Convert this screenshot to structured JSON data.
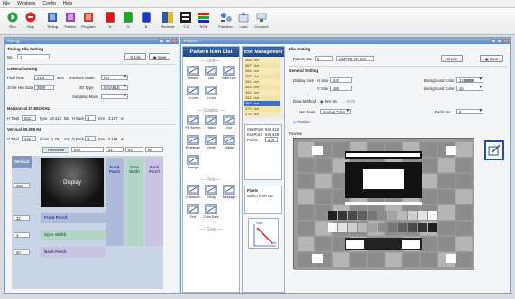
{
  "menu": [
    "File",
    "Windows",
    "Config",
    "Help"
  ],
  "toolbar": [
    {
      "label": "Run",
      "icon": "run-icon",
      "color": "#2e9a3c"
    },
    {
      "label": "Stop",
      "icon": "stop-icon",
      "color": "#d42a2a"
    },
    {
      "label": "Timing",
      "icon": "timing-icon",
      "color": "#3060c0"
    },
    {
      "label": "Pattern",
      "icon": "pattern-icon",
      "color": "#9a40c0"
    },
    {
      "label": "Program",
      "icon": "program-icon",
      "color": "#d63a2a"
    },
    {
      "label": "R",
      "icon": "red-icon",
      "color": "#e01818"
    },
    {
      "label": "G",
      "icon": "green-icon",
      "color": "#18b018"
    },
    {
      "label": "B",
      "icon": "blue-icon",
      "color": "#1838d8"
    },
    {
      "label": "Reverse",
      "icon": "reverse-icon",
      "color": "#2a5aa8"
    },
    {
      "label": "Y-Z",
      "icon": "yz-icon",
      "color": "#1a1a1a"
    },
    {
      "label": "RGB",
      "icon": "rgb-icon",
      "color": "#c02020"
    },
    {
      "label": "Function",
      "icon": "function-icon",
      "color": "#4a7ac8"
    },
    {
      "label": "Load",
      "icon": "load-icon",
      "color": "#4a7ac8"
    },
    {
      "label": "Connect",
      "icon": "connect-icon",
      "color": "#3a8a3a"
    }
  ],
  "timing": {
    "title": "Timing",
    "file_section": "Timing File Setting",
    "no_label": "No.",
    "no_value": "1",
    "list_btn": "List",
    "save_btn": "Save",
    "general_section": "General Setting",
    "pixel_rate_label": "Pixel Rate",
    "pixel_rate_value": "31.5",
    "pixel_rate_unit": "Mhz",
    "interlace_label": "Interlace Mode",
    "interlace_value": "NO",
    "bitdata_label": "10-bit Hex Data",
    "bitdata_value": "3900",
    "threed_label": "3D Type",
    "threed_value": "DISABLE",
    "sampling_label": "Sampling Mode",
    "horizontal_section": "Horizontal 37.861 KHz",
    "h_total_label": "H Total",
    "h_total_value": "832",
    "h_fporch_label": "Fpor",
    "h_fporch_value": "26.413",
    "h_fporch_unit": "kB",
    "h_back_label": "H Back",
    "h_back_value": "4",
    "h_back_unit": "mm",
    "h_last_value": "3.167",
    "h_last_unit": "m",
    "vertical_section": "Vertical 85.008 Hz",
    "v_total_label": "V Total",
    "v_total_value": "445",
    "v_lines_label": "Lines",
    "v_lines_value": "11.764",
    "v_lines_unit": "mS",
    "v_back_label": "V Back",
    "v_back_value": "3",
    "v_back_unit": "mm",
    "v_last_value": "0.119",
    "v_last_unit": "m",
    "diag_horizontal": "Horizontal",
    "diag_h_display": "640",
    "diag_h_front": "32",
    "diag_h_sync": "64",
    "diag_h_back": "96",
    "diag_vertical": "Vertical",
    "diag_v_display": "350",
    "diag_display": "Display",
    "front_porch": "Front Porch",
    "sync_width": "Sync Width",
    "back_porch": "Back Porch",
    "diag_v_front": "32",
    "diag_v_sync": "3",
    "diag_v_back": "60"
  },
  "pattern": {
    "title": "Pattern",
    "icon_list_title": "Pattern Icon List",
    "groups": [
      "Line",
      "Graphic",
      "Text",
      "Gray"
    ],
    "line_items": [
      "Window",
      "Line",
      "Start Line",
      "H-Line",
      "V-Line"
    ],
    "graphic_items": [
      "Fill Screen",
      "Hatch",
      "Dot",
      "Rectangle",
      "Circle",
      "Ellipse",
      "Triangle"
    ],
    "text_items": [
      "Character",
      "String",
      "Message",
      "Text",
      "Color Bars"
    ],
    "icon_mgmt_title": "Icon Management",
    "icon_mgmt_items": [
      "388 Line",
      "387 Line",
      "386 Line",
      "385 Line",
      "384 Line",
      "383 Line",
      "382 Line",
      "381 Line",
      "380 Line",
      "379 Line",
      "378 Line"
    ],
    "start_label": "StartPoint",
    "start_value": "549,418",
    "end_label": "EndPoint",
    "end_value": "549,429",
    "points_label": "Points",
    "points_value": "440",
    "pixels_label": "Pixels",
    "pixels_value": "Select Pixel No.",
    "diagram_start": "Start",
    "diagram_end": "End",
    "file_section": "File Setting",
    "pattern_no_label": "Pattern No.",
    "pattern_no_value": "5",
    "pattern_name": "SMPTE RP-133",
    "list_btn": "List",
    "save_btn": "Save",
    "general_section": "General Setting",
    "display_size_label": "Display Size",
    "h_size_label": "H Size",
    "h_size_value": "640",
    "v_size_label": "V Size",
    "v_size_value": "480",
    "bg_color_label": "Background Color",
    "bg_color_value": "22",
    "bg_color2_label": "Background Color",
    "bg_color2_value": "15",
    "draw_method_label": "Draw Method",
    "draw_opt1": "Pen No",
    "draw_opt2": "RGB",
    "pen_form_label": "Pen Form",
    "pen_form_value": "Analog Color",
    "radio_no_label": "Radio No",
    "radio_no_value": "0",
    "positive_label": "Positive",
    "preview_label": "Preview"
  }
}
